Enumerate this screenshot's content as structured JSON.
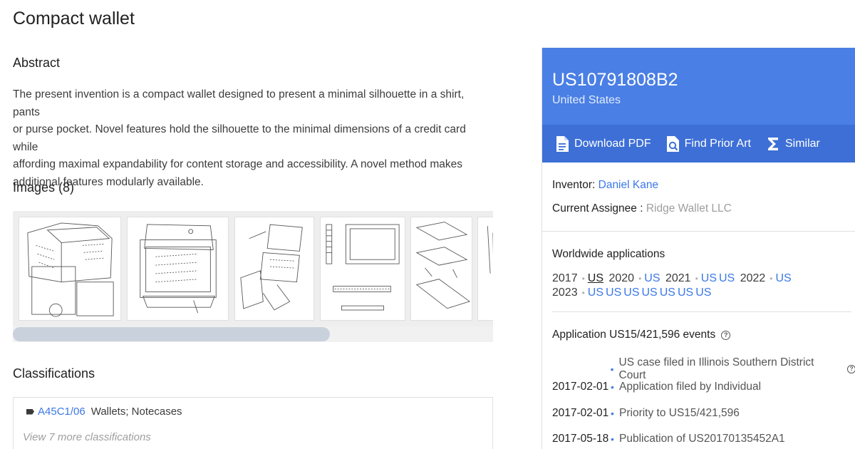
{
  "title": "Compact wallet",
  "abstract": {
    "heading": "Abstract",
    "lines": [
      "The present invention is a compact wallet designed to present a minimal silhouette in a shirt, pants",
      "or purse pocket. Novel features hold the silhouette to the minimal dimensions of a credit card while",
      "affording maximal expandability for content storage and accessibility. A novel method makes",
      "additional features modularly available."
    ]
  },
  "images": {
    "heading": "Images (8)"
  },
  "classifications": {
    "heading": "Classifications",
    "items": [
      {
        "code": "A45C1/06",
        "description": "Wallets; Notecases"
      }
    ],
    "view_more": "View 7 more classifications"
  },
  "patent": {
    "number": "US10791808B2",
    "country": "United States",
    "actions": [
      {
        "label": "Download PDF",
        "icon": "pdf-icon"
      },
      {
        "label": "Find Prior Art",
        "icon": "search-document-icon"
      },
      {
        "label": "Similar",
        "icon": "sigma-icon"
      }
    ],
    "inventor_label": "Inventor:",
    "inventor": "Daniel Kane",
    "assignee_label": "Current Assignee :",
    "assignee": "Ridge Wallet LLC"
  },
  "worldwide": {
    "heading": "Worldwide applications",
    "years": [
      {
        "year": "2017",
        "codes": [
          "US"
        ],
        "active_index": 0
      },
      {
        "year": "2020",
        "codes": [
          "US"
        ]
      },
      {
        "year": "2021",
        "codes": [
          "US",
          "US"
        ]
      },
      {
        "year": "2022",
        "codes": [
          "US"
        ]
      },
      {
        "year": "2023",
        "codes": [
          "US",
          "US",
          "US",
          "US",
          "US",
          "US",
          "US"
        ]
      }
    ]
  },
  "events": {
    "heading": "Application US15/421,596 events",
    "items": [
      {
        "date": "",
        "text": "US case filed in Illinois Southern District Court",
        "help": true
      },
      {
        "date": "2017-02-01",
        "text": "Application filed by Individual"
      },
      {
        "date": "2017-02-01",
        "text": "Priority to US15/421,596"
      },
      {
        "date": "2017-05-18",
        "text": "Publication of US20170135452A1"
      }
    ]
  },
  "colors": {
    "accent": "#4a7fe5",
    "accent_dark": "#3d6fd6",
    "link": "#3b78e7"
  }
}
